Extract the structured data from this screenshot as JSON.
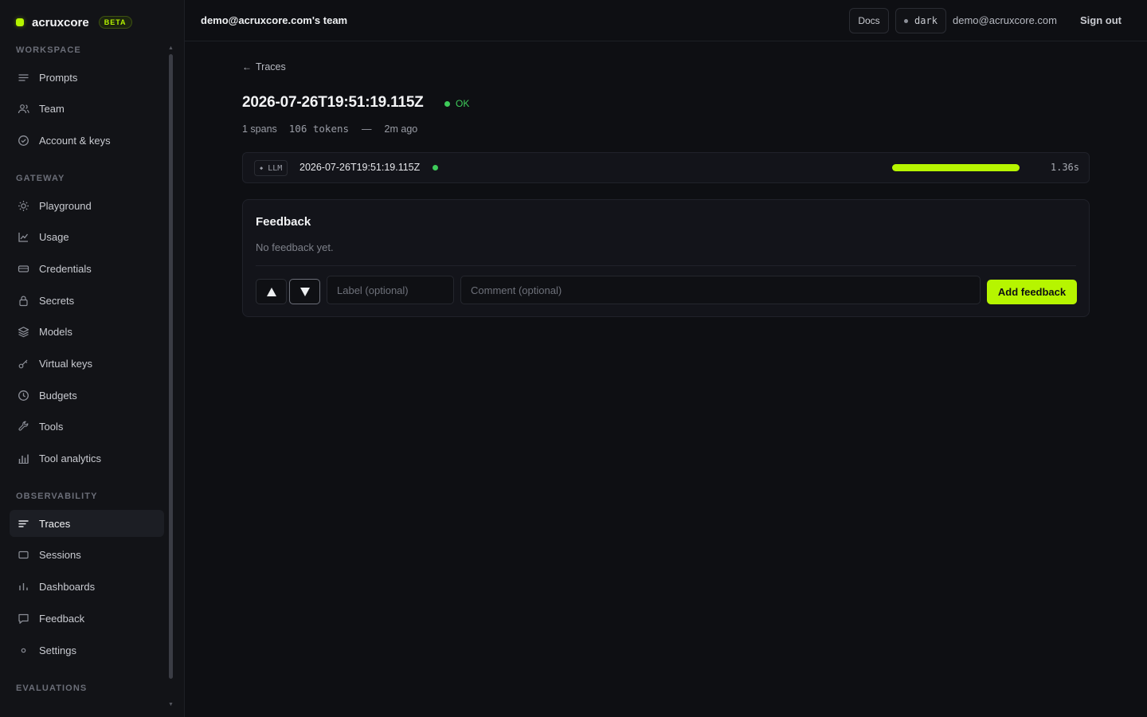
{
  "brand": {
    "name": "acruxcore",
    "badge": "BETA",
    "color": "#b6f500"
  },
  "sidebar": {
    "sections": [
      {
        "title": "WORKSPACE",
        "items": [
          {
            "label": "Prompts",
            "icon": "list-icon"
          },
          {
            "label": "Team",
            "icon": "users-icon"
          },
          {
            "label": "Account & keys",
            "icon": "check-circle-icon"
          }
        ]
      },
      {
        "title": "GATEWAY",
        "items": [
          {
            "label": "Playground",
            "icon": "sun-icon"
          },
          {
            "label": "Usage",
            "icon": "line-chart-icon"
          },
          {
            "label": "Credentials",
            "icon": "card-icon"
          },
          {
            "label": "Secrets",
            "icon": "lock-icon"
          },
          {
            "label": "Models",
            "icon": "layers-icon"
          },
          {
            "label": "Virtual keys",
            "icon": "key-icon"
          },
          {
            "label": "Budgets",
            "icon": "clock-icon"
          },
          {
            "label": "Tools",
            "icon": "wrench-icon"
          },
          {
            "label": "Tool analytics",
            "icon": "bar-chart-icon"
          }
        ]
      },
      {
        "title": "OBSERVABILITY",
        "items": [
          {
            "label": "Traces",
            "icon": "traces-icon",
            "active": true
          },
          {
            "label": "Sessions",
            "icon": "square-icon"
          },
          {
            "label": "Dashboards",
            "icon": "bars-icon"
          },
          {
            "label": "Feedback",
            "icon": "message-icon"
          },
          {
            "label": "Settings",
            "icon": "dot-icon"
          }
        ]
      },
      {
        "title": "EVALUATIONS",
        "items": []
      }
    ]
  },
  "header": {
    "team": "demo@acruxcore.com's team",
    "docs": "Docs",
    "theme": "dark",
    "email": "demo@acruxcore.com",
    "signout": "Sign out"
  },
  "trace": {
    "back_label": "Traces",
    "title": "2026-07-26T19:51:19.115Z",
    "status": "OK",
    "spans": "1 spans",
    "tokens": "106 tokens",
    "separator": "—",
    "age": "2m ago"
  },
  "span": {
    "kind": "LLM",
    "name": "2026-07-26T19:51:19.115Z",
    "duration": "1.36s",
    "progress": 1.0
  },
  "feedback": {
    "title": "Feedback",
    "empty": "No feedback yet.",
    "label_placeholder": "Label (optional)",
    "comment_placeholder": "Comment (optional)",
    "submit": "Add feedback"
  }
}
